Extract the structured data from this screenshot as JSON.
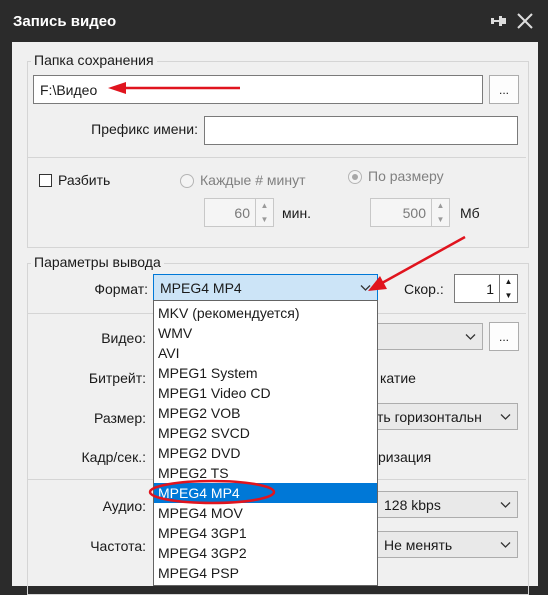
{
  "window": {
    "title": "Запись видео",
    "pin_icon": "pin-icon",
    "close_icon": "close-icon"
  },
  "save_folder": {
    "group_label": "Папка сохранения",
    "path_value": "F:\\Видео",
    "browse_label": "...",
    "prefix_label": "Префикс имени:",
    "prefix_value": ""
  },
  "split": {
    "checkbox_label": "Разбить",
    "checked": false,
    "every_minutes_label": "Каждые # минут",
    "by_size_label": "По размеру",
    "minutes_value": "60",
    "minutes_unit": "мин.",
    "size_value": "500",
    "size_unit": "Мб"
  },
  "output": {
    "group_label": "Параметры вывода",
    "format_label": "Формат:",
    "format_value": "MPEG4 MP4",
    "speed_label": "Скор.:",
    "speed_value": "1",
    "video_label": "Видео:",
    "video_browse_label": "...",
    "bitrate_label": "Битрейт:",
    "bitrate_partial": "катие",
    "size_label": "Размер:",
    "size_partial": "ть горизонтальн",
    "framerate_label": "Кадр/сек.:",
    "framerate_partial": "ризация",
    "audio_label": "Аудио:",
    "audio_value": "128 kbps",
    "frequency_label": "Частота:",
    "frequency_value": "Не менять"
  },
  "format_options": [
    "MKV (рекомендуется)",
    "WMV",
    "AVI",
    "MPEG1 System",
    "MPEG1 Video CD",
    "MPEG2 VOB",
    "MPEG2 SVCD",
    "MPEG2 DVD",
    "MPEG2 TS",
    "MPEG4 MP4",
    "MPEG4 MOV",
    "MPEG4 3GP1",
    "MPEG4 3GP2",
    "MPEG4 PSP"
  ],
  "format_selected_index": 9,
  "colors": {
    "titlebar": "#2b2b2b",
    "annotation_red": "#e0141e",
    "selection_blue": "#0078d7",
    "combo_highlight": "#cce4f7"
  }
}
